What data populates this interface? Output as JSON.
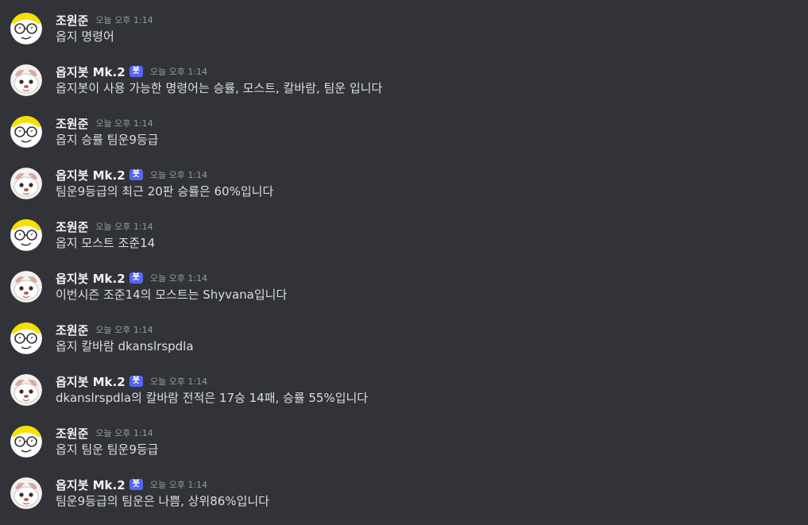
{
  "messages": [
    {
      "type": "user",
      "username": "조원준",
      "timestamp": "오늘 오후 1:14",
      "text": "옵지 명령어"
    },
    {
      "type": "bot",
      "username": "옵지봇 Mk.2",
      "bot_tag": "봇",
      "timestamp": "오늘 오후 1:14",
      "text": "옵지봇이 사용 가능한 명령어는 승률, 모스트, 칼바람, 팀운 입니다"
    },
    {
      "type": "user",
      "username": "조원준",
      "timestamp": "오늘 오후 1:14",
      "text": "옵지 승률 팀운9등급"
    },
    {
      "type": "bot",
      "username": "옵지봇 Mk.2",
      "bot_tag": "봇",
      "timestamp": "오늘 오후 1:14",
      "text": "팀운9등급의 최근 20판 승률은 60%입니다"
    },
    {
      "type": "user",
      "username": "조원준",
      "timestamp": "오늘 오후 1:14",
      "text": "옵지 모스트 조준14"
    },
    {
      "type": "bot",
      "username": "옵지봇 Mk.2",
      "bot_tag": "봇",
      "timestamp": "오늘 오후 1:14",
      "text": "이번시즌 조준14의 모스트는 Shyvana입니다"
    },
    {
      "type": "user",
      "username": "조원준",
      "timestamp": "오늘 오후 1:14",
      "text": "옵지 칼바람 dkanslrspdla"
    },
    {
      "type": "bot",
      "username": "옵지봇 Mk.2",
      "bot_tag": "봇",
      "timestamp": "오늘 오후 1:14",
      "text": "dkanslrspdla의 칼바람 전적은 17승 14패, 승률 55%입니다"
    },
    {
      "type": "user",
      "username": "조원준",
      "timestamp": "오늘 오후 1:14",
      "text": "옵지 팀운 팀운9등급"
    },
    {
      "type": "bot",
      "username": "옵지봇 Mk.2",
      "bot_tag": "봇",
      "timestamp": "오늘 오후 1:14",
      "text": "팀운9등급의 팀운은 나쁨, 상위86%입니다"
    }
  ],
  "icons": {
    "user_avatar": "glasses-face-avatar-icon",
    "bot_avatar": "poro-avatar-icon"
  },
  "colors": {
    "background": "#313338",
    "bot_tag": "#5865f2",
    "username": "#f2f3f5",
    "timestamp": "#949ba4",
    "text": "#dbdee1"
  }
}
